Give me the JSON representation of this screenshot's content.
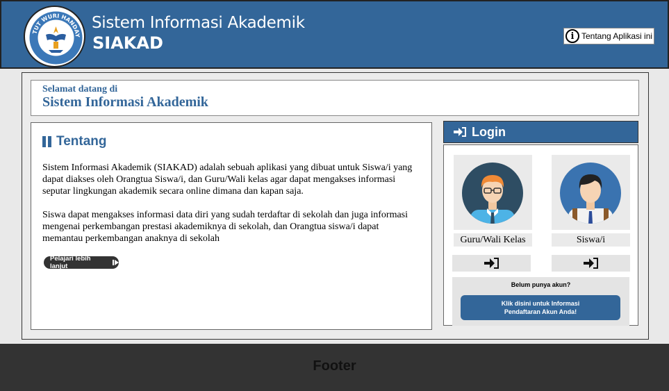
{
  "header": {
    "app_title": "Sistem Informasi Akademik",
    "app_short": "SIAKAD",
    "about_label": "Tentang Aplikasi ini",
    "logo_text": "TUT WURI HANDAYANI"
  },
  "welcome": {
    "subtitle": "Selamat datang di",
    "title": "Sistem Informasi Akademik"
  },
  "about": {
    "heading": "Tentang",
    "paragraph_1": "Sistem Informasi Akademik (SIAKAD) adalah sebuah aplikasi yang dibuat untuk Siswa/i yang dapat diakses oleh Orangtua Siswa/i, dan Guru/Wali kelas agar dapat mengakses informasi seputar lingkungan akademik secara online dimana dan kapan saja.",
    "paragraph_2": "Siswa dapat mengakses informasi data diri yang sudah terdaftar di sekolah dan juga informasi mengenai perkembangan prestasi akademiknya di sekolah, dan Orangtua siswa/i dapat memantau perkembangan anaknya di sekolah",
    "more_label": "Pelajari lebih lanjut"
  },
  "login": {
    "heading": "Login",
    "roles": [
      {
        "label": "Guru/Wali Kelas"
      },
      {
        "label": "Siswa/i"
      }
    ],
    "register_question": "Belum punya akun?",
    "register_line_1": "Klik disini untuk Informasi",
    "register_line_2": "Pendaftaran Akun Anda!"
  },
  "footer": {
    "label": "Footer"
  },
  "colors": {
    "primary": "#336699",
    "footer": "#333333"
  }
}
